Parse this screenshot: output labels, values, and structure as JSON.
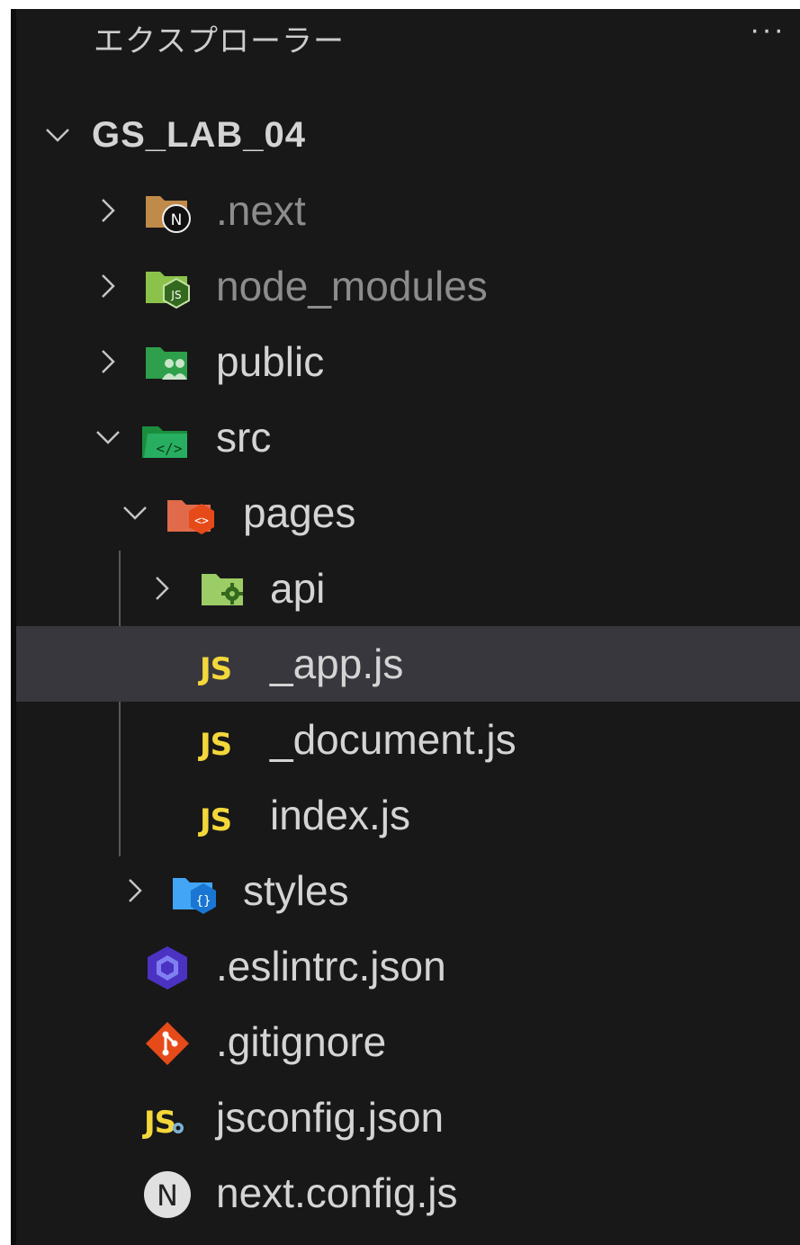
{
  "explorer": {
    "title": "エクスプローラー",
    "more_label": "···"
  },
  "tree": {
    "root": "GS_LAB_04",
    "items": [
      {
        "label": ".next",
        "icon": "nextjs-folder-icon"
      },
      {
        "label": "node_modules",
        "icon": "node-folder-icon"
      },
      {
        "label": "public",
        "icon": "public-folder-icon"
      },
      {
        "label": "src",
        "icon": "src-folder-icon"
      },
      {
        "label": "pages",
        "icon": "pages-folder-icon"
      },
      {
        "label": "api",
        "icon": "api-folder-icon"
      },
      {
        "label": "_app.js",
        "icon": "js-file-icon",
        "badge": "JS"
      },
      {
        "label": "_document.js",
        "icon": "js-file-icon",
        "badge": "JS"
      },
      {
        "label": "index.js",
        "icon": "js-file-icon",
        "badge": "JS"
      },
      {
        "label": "styles",
        "icon": "styles-folder-icon"
      },
      {
        "label": ".eslintrc.json",
        "icon": "eslint-icon"
      },
      {
        "label": ".gitignore",
        "icon": "git-icon"
      },
      {
        "label": "jsconfig.json",
        "icon": "jsconfig-icon",
        "badge": "JS"
      },
      {
        "label": "next.config.js",
        "icon": "nextjs-icon"
      }
    ]
  }
}
